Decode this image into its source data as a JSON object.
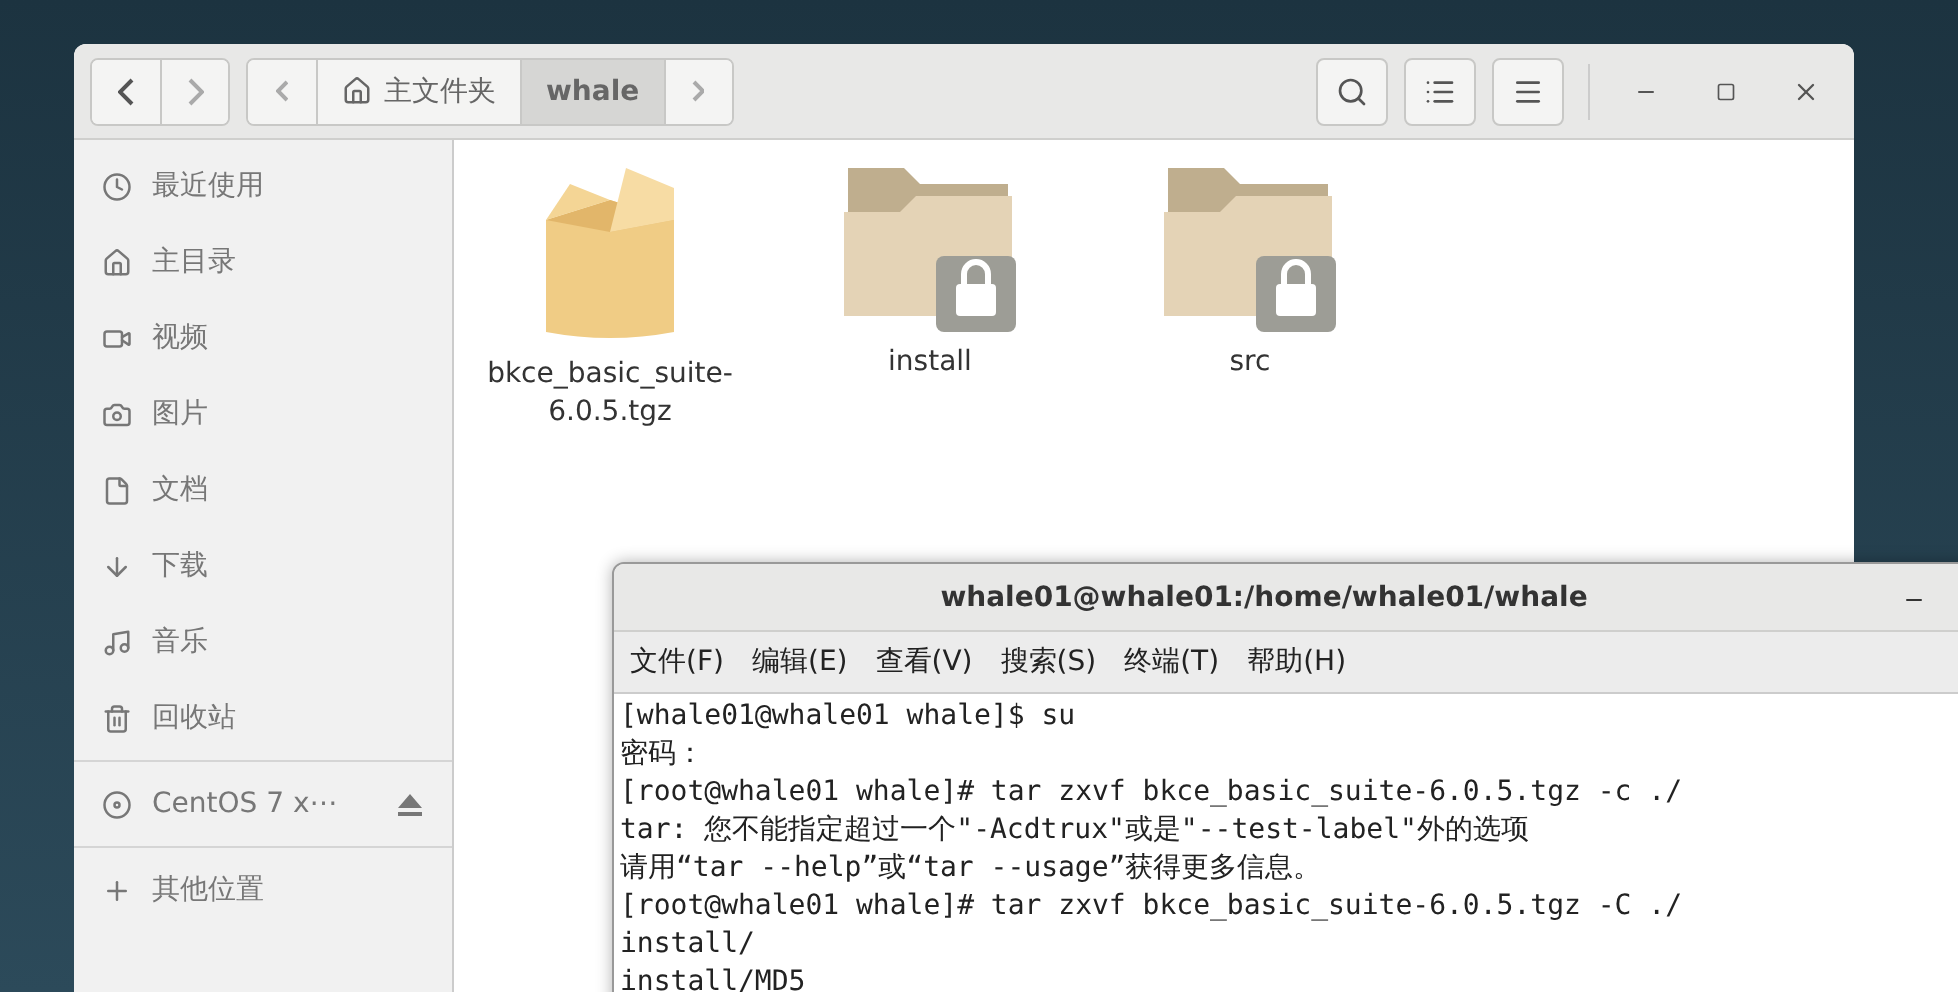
{
  "file_manager": {
    "path": [
      {
        "label": "主文件夹",
        "selected": false
      },
      {
        "label": "whale",
        "selected": true
      }
    ],
    "sidebar": {
      "places": [
        {
          "label": "最近使用"
        },
        {
          "label": "主目录"
        },
        {
          "label": "视频"
        },
        {
          "label": "图片"
        },
        {
          "label": "文档"
        },
        {
          "label": "下载"
        },
        {
          "label": "音乐"
        },
        {
          "label": "回收站"
        }
      ],
      "devices": [
        {
          "label": "CentOS 7 x⋯"
        }
      ],
      "other": [
        {
          "label": "其他位置"
        }
      ]
    },
    "files": [
      {
        "name": "bkce_basic_suite-6.0.5.tgz",
        "kind": "archive",
        "locked": false
      },
      {
        "name": "install",
        "kind": "folder",
        "locked": true
      },
      {
        "name": "src",
        "kind": "folder",
        "locked": true
      }
    ]
  },
  "terminal": {
    "title": "whale01@whale01:/home/whale01/whale",
    "menu": [
      "文件(F)",
      "编辑(E)",
      "查看(V)",
      "搜索(S)",
      "终端(T)",
      "帮助(H)"
    ],
    "lines": [
      "[whale01@whale01 whale]$ su",
      "密码：",
      "[root@whale01 whale]# tar zxvf bkce_basic_suite-6.0.5.tgz -c ./",
      "tar: 您不能指定超过一个\"-Acdtrux\"或是\"--test-label\"外的选项",
      "请用“tar --help”或“tar --usage”获得更多信息。",
      "[root@whale01 whale]# tar zxvf bkce_basic_suite-6.0.5.tgz -C ./",
      "install/",
      "install/MD5"
    ]
  }
}
